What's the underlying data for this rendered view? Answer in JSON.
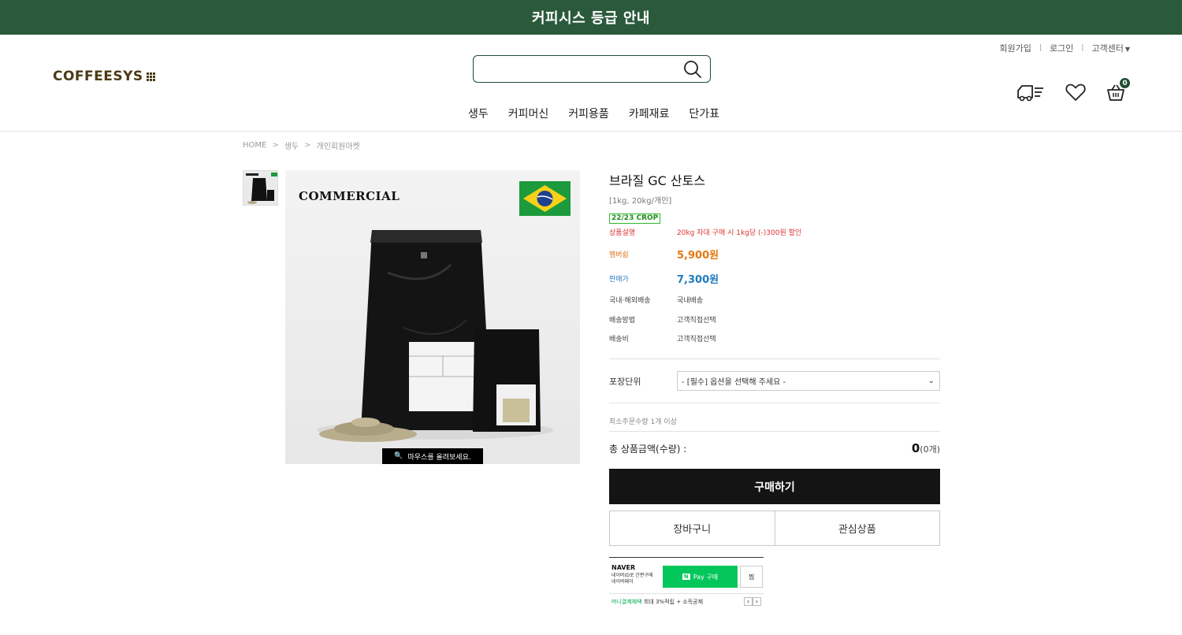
{
  "banner": {
    "text": "커피시스 등급 안내"
  },
  "header": {
    "logo": "COFFEESYS",
    "search": {
      "value": "",
      "placeholder": ""
    },
    "topnav": {
      "signup": "회원가입",
      "login": "로그인",
      "support": "고객센터"
    },
    "gnb": [
      "생두",
      "커피머신",
      "커피용품",
      "카페재료",
      "단가표"
    ],
    "cart_count": "0"
  },
  "breadcrumb": [
    "HOME",
    "생두",
    "개인회원마켓"
  ],
  "image": {
    "commercial_text": "COMMERCIAL",
    "zoom_hint": "마우스를 올려보세요."
  },
  "product": {
    "title": "브라질 GC 산토스",
    "subtitle": "[1kg, 20kg/개인]",
    "crop": "22/23 CROP",
    "specs": {
      "desc_label": "상품설명",
      "desc_value": "20kg 자대 구매 시 1kg당 (-)300원 할인",
      "member_label": "멤버쉽",
      "member_price": "5,900원",
      "sale_label": "판매가",
      "sale_price": "7,300원",
      "ship_region_label": "국내·해외배송",
      "ship_region_value": "국내배송",
      "ship_method_label": "배송방법",
      "ship_method_value": "고객직접선택",
      "ship_fee_label": "배송비",
      "ship_fee_value": "고객직접선택"
    },
    "option": {
      "label": "포장단위",
      "selected": "- [필수] 옵션을 선택해 주세요 -"
    },
    "min_qty": "최소주문수량 1개 이상",
    "total": {
      "label": "총 상품금액(수량) :",
      "amount": "0",
      "count": "(0개)"
    },
    "buttons": {
      "buy": "구매하기",
      "cart": "장바구니",
      "wish": "관심상품"
    }
  },
  "naverpay": {
    "logo": "NAVER",
    "sub1": "네이버ID로 간편구매",
    "sub2": "네이버페이",
    "btn_box": "N",
    "btn_text": "Pay 구매",
    "jjim": "찜",
    "benefit_green": "머니결제혜택",
    "benefit_text": "최대 3%적립 + 소득공제"
  },
  "colors": {
    "brand_green": "#2a5a3b",
    "member_price": "#e47912",
    "sale_price": "#1f7bbf",
    "buy_button": "#141414",
    "naver_green": "#03c75a"
  }
}
